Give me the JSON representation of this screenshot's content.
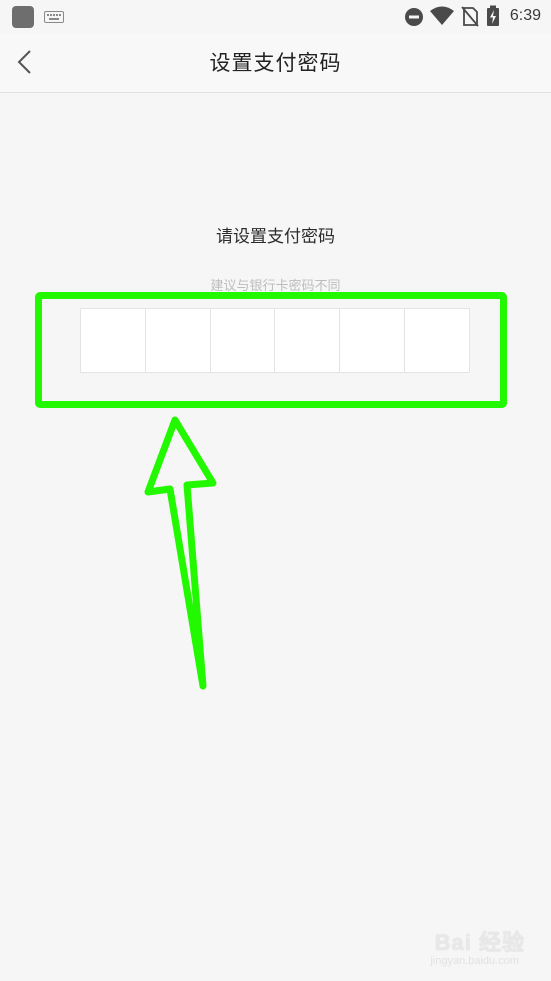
{
  "status_bar": {
    "time": "6:39",
    "icons": [
      "app-icon",
      "keyboard-icon",
      "do-not-disturb-icon",
      "wifi-icon",
      "no-sim-icon",
      "battery-charging-icon"
    ]
  },
  "header": {
    "back_icon": "chevron-left-icon",
    "title": "设置支付密码"
  },
  "main": {
    "prompt": "请设置支付密码",
    "hint": "建议与银行卡密码不同",
    "pin_cells": [
      "",
      "",
      "",
      "",
      "",
      ""
    ]
  },
  "annotation": {
    "color": "#22f800"
  },
  "watermark": {
    "text": "Bai 经验",
    "sub": "jingyan.baidu.com"
  }
}
